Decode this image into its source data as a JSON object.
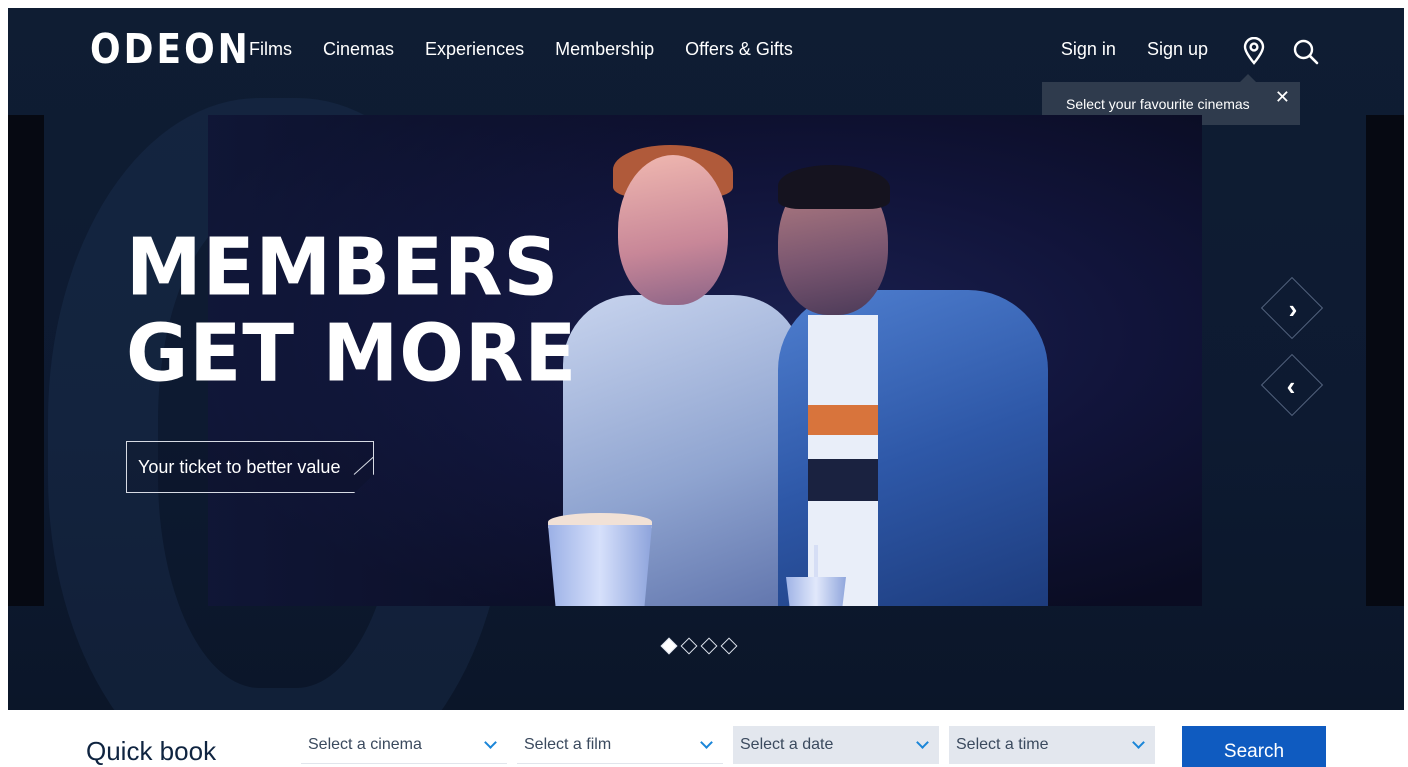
{
  "header": {
    "logo": "ODEON",
    "nav": [
      "Films",
      "Cinemas",
      "Experiences",
      "Membership",
      "Offers & Gifts"
    ],
    "sign_in": "Sign in",
    "sign_up": "Sign up"
  },
  "tooltip": {
    "text": "Select your favourite cinemas",
    "close": "✕"
  },
  "hero": {
    "headline_line1": "MEMBERS",
    "headline_line2": "GET MORE",
    "cta": "Your ticket to better value",
    "next_arrow": "›",
    "prev_arrow": "‹",
    "slide_count": 4,
    "active_slide": 1
  },
  "quick_book": {
    "title": "Quick book",
    "cinema_placeholder": "Select a cinema",
    "film_placeholder": "Select a film",
    "date_placeholder": "Select a date",
    "time_placeholder": "Select a time",
    "search_label": "Search"
  },
  "colors": {
    "background_dark": "#0f1d33",
    "accent_blue": "#0f5bc0",
    "chevron_blue": "#1b86d8",
    "tooltip_bg": "#2f3b4d"
  }
}
